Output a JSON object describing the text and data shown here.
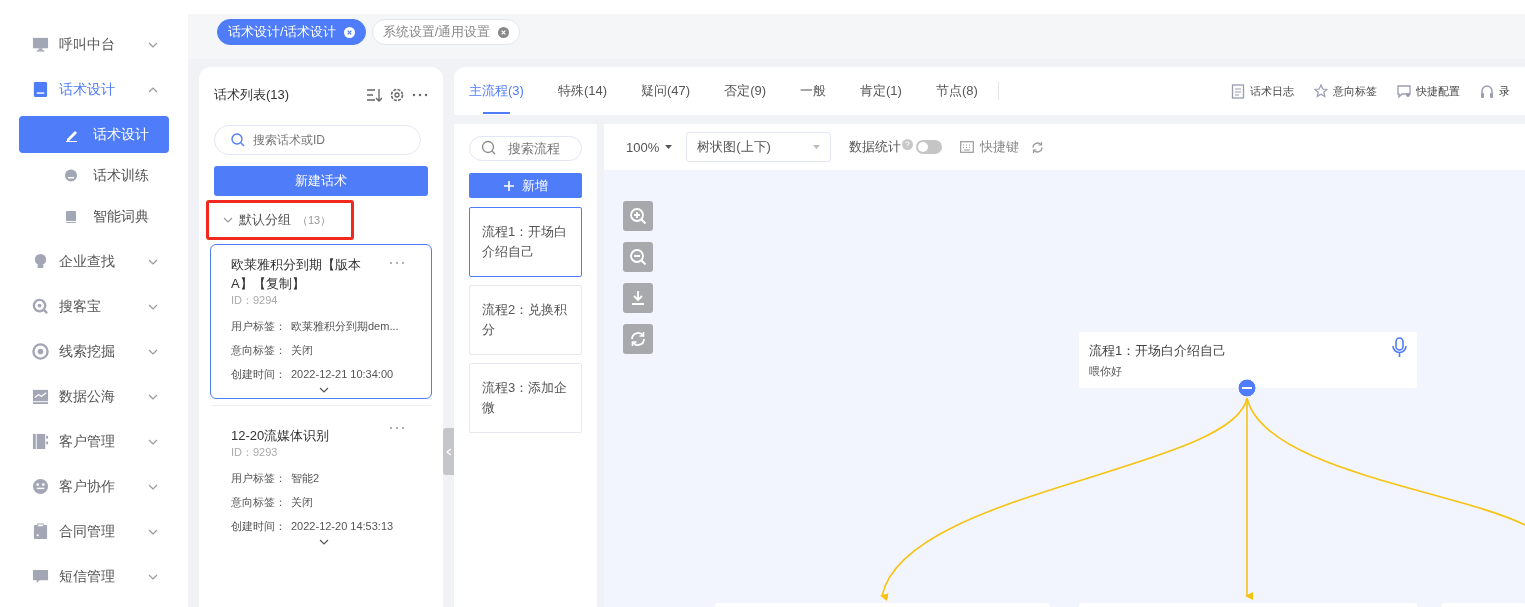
{
  "sidebar": {
    "items": [
      {
        "label": "呼叫中台",
        "expanded": false
      },
      {
        "label": "话术设计",
        "expanded": true,
        "children": [
          {
            "label": "话术设计",
            "selected": true
          },
          {
            "label": "话术训练",
            "selected": false
          },
          {
            "label": "智能词典",
            "selected": false
          }
        ]
      },
      {
        "label": "企业查找",
        "expanded": false
      },
      {
        "label": "搜客宝",
        "expanded": false
      },
      {
        "label": "线索挖掘",
        "expanded": false
      },
      {
        "label": "数据公海",
        "expanded": false
      },
      {
        "label": "客户管理",
        "expanded": false
      },
      {
        "label": "客户协作",
        "expanded": false
      },
      {
        "label": "合同管理",
        "expanded": false
      },
      {
        "label": "短信管理",
        "expanded": false
      }
    ]
  },
  "page_tabs": [
    {
      "label": "话术设计/话术设计",
      "selected": true
    },
    {
      "label": "系统设置/通用设置",
      "selected": false
    }
  ],
  "script_list": {
    "title": "话术列表(13)",
    "search": {
      "placeholder": "搜索话术或ID"
    },
    "new_button": "新建话术",
    "group": {
      "label": "默认分组",
      "count": "（13）",
      "expanded": true,
      "annotated": true
    },
    "cards": [
      {
        "title": "欧莱雅积分到期【版本A】【复制】",
        "id": "ID：9294",
        "selected": true,
        "fields": [
          {
            "label": "用户标签：",
            "value": "欧莱雅积分到期dem..."
          },
          {
            "label": "意向标签：",
            "value": "关闭"
          },
          {
            "label": "创建时间：",
            "value": "2022-12-21 10:34:00"
          }
        ]
      },
      {
        "title": "12-20流媒体识别",
        "id": "ID：9293",
        "selected": false,
        "fields": [
          {
            "label": "用户标签：",
            "value": "智能2"
          },
          {
            "label": "意向标签：",
            "value": "关闭"
          },
          {
            "label": "创建时间：",
            "value": "2022-12-20 14:53:13"
          }
        ]
      }
    ]
  },
  "flow_tabs": [
    {
      "label": "主流程(3)",
      "selected": true
    },
    {
      "label": "特殊(14)",
      "selected": false
    },
    {
      "label": "疑问(47)",
      "selected": false
    },
    {
      "label": "否定(9)",
      "selected": false
    },
    {
      "label": "一般",
      "selected": false
    },
    {
      "label": "肯定(1)",
      "selected": false
    },
    {
      "label": "节点(8)",
      "selected": false
    }
  ],
  "tools": [
    "话术日志",
    "意向标签",
    "快捷配置",
    "录"
  ],
  "flows": {
    "search": {
      "placeholder": "搜索流程"
    },
    "add_button": "新增",
    "items": [
      {
        "label": "流程1：开场白介绍自己",
        "selected": true
      },
      {
        "label": "流程2：兑换积分",
        "selected": false
      },
      {
        "label": "流程3：添加企微",
        "selected": false
      }
    ]
  },
  "toolbar": {
    "zoom": "100%",
    "layout": "树状图(上下)",
    "stats_label": "数据统计",
    "stats_on": false,
    "shortcut": "快捷键"
  },
  "canvas": {
    "node": {
      "title": "流程1：开场白介绍自己",
      "text": "喂你好",
      "expanded": true
    }
  }
}
